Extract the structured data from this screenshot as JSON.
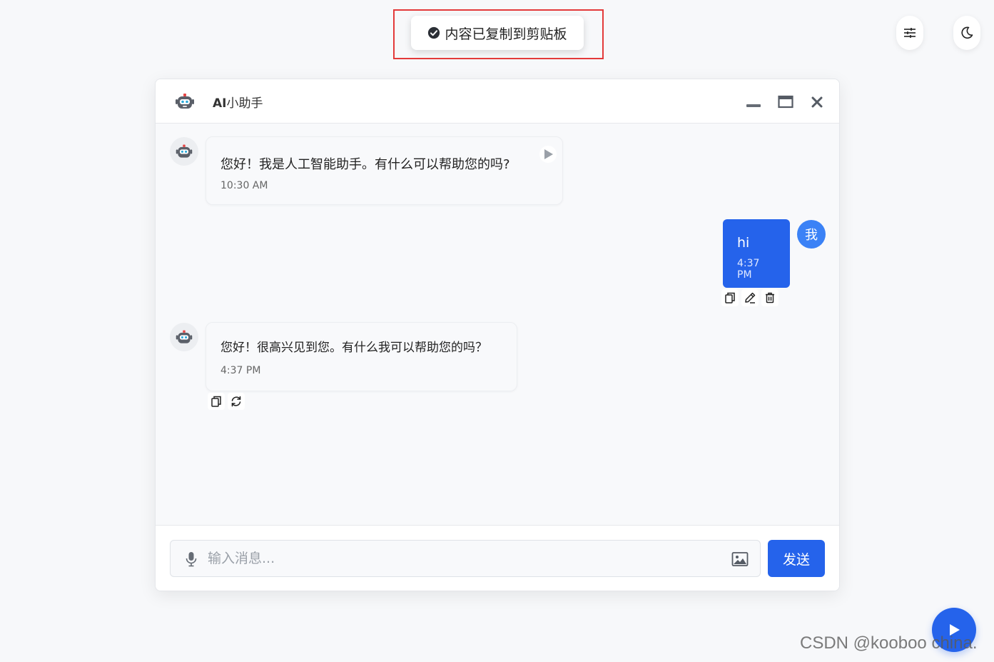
{
  "toast": {
    "text": "内容已复制到剪贴板"
  },
  "header": {
    "title_bold": "AI",
    "title_rest": "小助手"
  },
  "messages": [
    {
      "role": "bot",
      "text": "您好！我是人工智能助手。有什么可以帮助您的吗?",
      "time": "10:30 AM"
    },
    {
      "role": "user",
      "avatar": "我",
      "text": "hi",
      "time": "4:37 PM"
    },
    {
      "role": "bot",
      "text": "您好！很高兴见到您。有什么我可以帮助您的吗？",
      "time": "4:37 PM"
    }
  ],
  "input": {
    "placeholder": "输入消息...",
    "value": ""
  },
  "send": {
    "label": "发送"
  },
  "watermark": "CSDN @kooboo china.",
  "colors": {
    "accent": "#2563eb",
    "highlight_border": "#e33a3a"
  }
}
